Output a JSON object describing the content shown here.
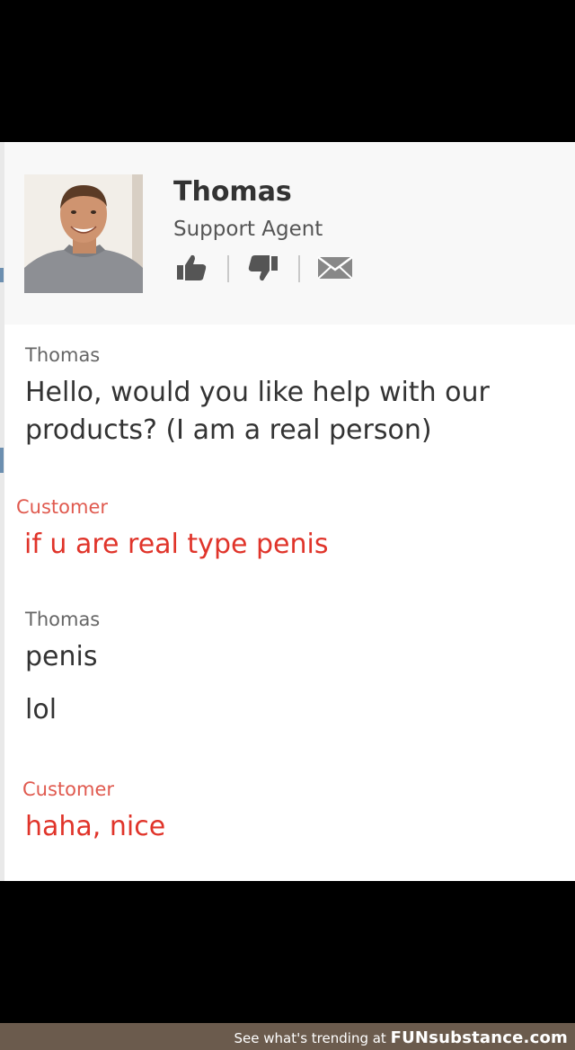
{
  "agent": {
    "name": "Thomas",
    "role": "Support Agent"
  },
  "messages": [
    {
      "sender": "Thomas",
      "role": "agent",
      "lines": [
        "Hello, would you like help with our",
        "products? (I am a real person)"
      ]
    },
    {
      "sender": "Customer",
      "role": "customer",
      "lines": [
        "if u are real type penis"
      ]
    },
    {
      "sender": "Thomas",
      "role": "agent",
      "lines": [
        "penis",
        "lol"
      ]
    },
    {
      "sender": "Customer",
      "role": "customer",
      "lines": [
        "haha, nice"
      ]
    }
  ],
  "icons": {
    "like": "thumbs-up-icon",
    "dislike": "thumbs-down-icon",
    "email": "envelope-icon"
  },
  "colors": {
    "agent_text": "#333333",
    "customer_text": "#e0342a",
    "customer_label": "#e05a4f",
    "header_bg": "#f8f8f8"
  },
  "footer": {
    "prefix": "See what's trending at",
    "brand": "FUNsubstance.com"
  }
}
